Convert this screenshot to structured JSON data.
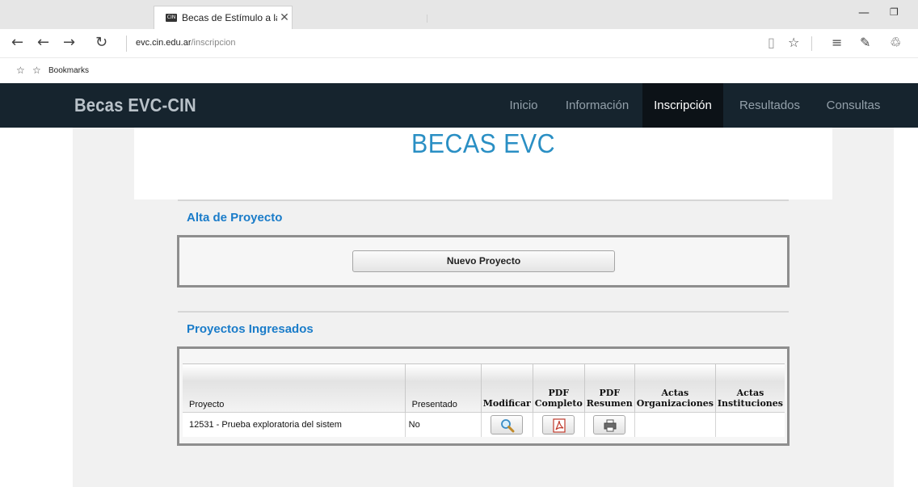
{
  "browser": {
    "tab_title": "Becas de Estímulo a las",
    "tab_close": "✕",
    "favicon_text": "CIN",
    "url_domain": "evc.cin.edu.ar",
    "url_path": "/inscripcion",
    "bookmarks_label": "Bookmarks"
  },
  "site": {
    "brand": "Becas EVC-CIN",
    "nav": [
      "Inicio",
      "Información",
      "Inscripción",
      "Resultados",
      "Consultas"
    ],
    "active_nav": "Inscripción",
    "banner_title": "BECAS EVC"
  },
  "alta": {
    "title": "Alta de Proyecto",
    "new_button": "Nuevo Proyecto"
  },
  "proyectos": {
    "title": "Proyectos Ingresados",
    "columns": [
      "Proyecto",
      "Presentado",
      "Modificar",
      "PDF Completo",
      "PDF Resumen",
      "Actas Organizaciones",
      "Actas Instituciones"
    ],
    "rows": [
      {
        "proyecto": "12531 - Prueba exploratoria del sistem",
        "presentado": "No"
      }
    ]
  },
  "colors": {
    "navbar": "#16242e",
    "accent": "#1a7cc9",
    "banner_title": "#2a8fc4"
  },
  "icons": [
    "back-icon",
    "forward-icon",
    "refresh-icon",
    "reading-view-icon",
    "favorite-star-icon",
    "hub-icon",
    "web-note-icon",
    "share-icon",
    "magnifier-icon",
    "pdf-icon",
    "printer-icon"
  ]
}
